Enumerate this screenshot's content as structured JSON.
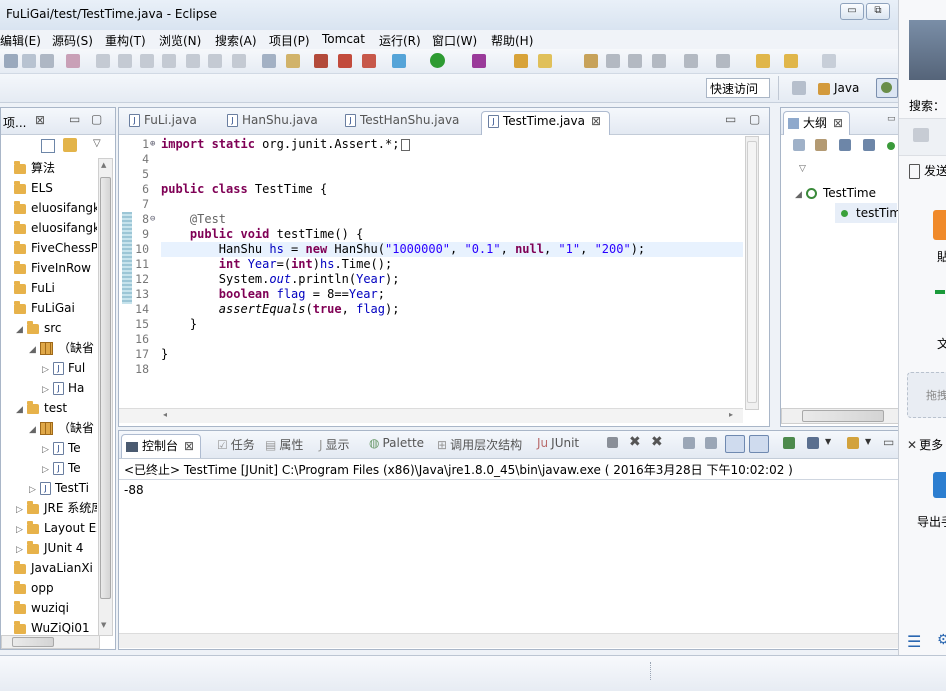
{
  "window": {
    "title": "FuLiGai/test/TestTime.java - Eclipse",
    "btn_min": "▭",
    "btn_max": "⧉"
  },
  "menu": [
    "编辑(E)",
    "源码(S)",
    "重构(T)",
    "浏览(N)",
    "搜索(A)",
    "项目(P)",
    "Tomcat",
    "运行(R)",
    "窗口(W)",
    "帮助(H)"
  ],
  "toolbar": {
    "quick_access": "快速访问",
    "perspective": "Java"
  },
  "explorer": {
    "tab": "项...",
    "rows": [
      {
        "indent": 0,
        "tw": "",
        "label": "算法",
        "kind": "proj"
      },
      {
        "indent": 0,
        "tw": "",
        "label": "ELS",
        "kind": "proj"
      },
      {
        "indent": 0,
        "tw": "",
        "label": "eluosifangku",
        "kind": "proj"
      },
      {
        "indent": 0,
        "tw": "",
        "label": "eluosifangku",
        "kind": "proj"
      },
      {
        "indent": 0,
        "tw": "",
        "label": "FiveChessPro",
        "kind": "proj"
      },
      {
        "indent": 0,
        "tw": "",
        "label": "FiveInRow",
        "kind": "proj"
      },
      {
        "indent": 0,
        "tw": "",
        "label": "FuLi",
        "kind": "proj"
      },
      {
        "indent": 0,
        "tw": "",
        "label": "FuLiGai",
        "kind": "proj"
      },
      {
        "indent": 1,
        "tw": "◢",
        "label": "src",
        "kind": "src"
      },
      {
        "indent": 2,
        "tw": "◢",
        "label": "（缺省",
        "kind": "pkg"
      },
      {
        "indent": 3,
        "tw": "▷",
        "label": "Ful",
        "kind": "java"
      },
      {
        "indent": 3,
        "tw": "▷",
        "label": "Ha",
        "kind": "java"
      },
      {
        "indent": 1,
        "tw": "◢",
        "label": "test",
        "kind": "src"
      },
      {
        "indent": 2,
        "tw": "◢",
        "label": "（缺省",
        "kind": "pkg"
      },
      {
        "indent": 3,
        "tw": "▷",
        "label": "Te",
        "kind": "java"
      },
      {
        "indent": 3,
        "tw": "▷",
        "label": "Te",
        "kind": "java"
      },
      {
        "indent": 2,
        "tw": "▷",
        "label": "TestTi",
        "kind": "java"
      },
      {
        "indent": 1,
        "tw": "▷",
        "label": "JRE 系统库",
        "kind": "lib"
      },
      {
        "indent": 1,
        "tw": "▷",
        "label": "Layout Ex",
        "kind": "proj"
      },
      {
        "indent": 1,
        "tw": "▷",
        "label": "JUnit 4",
        "kind": "lib"
      },
      {
        "indent": 0,
        "tw": "",
        "label": "JavaLianXi",
        "kind": "proj"
      },
      {
        "indent": 0,
        "tw": "",
        "label": "opp",
        "kind": "proj"
      },
      {
        "indent": 0,
        "tw": "",
        "label": "wuziqi",
        "kind": "proj"
      },
      {
        "indent": 0,
        "tw": "",
        "label": "WuZiQi01",
        "kind": "proj"
      }
    ]
  },
  "editor": {
    "tabs": [
      "FuLi.java",
      "HanShu.java",
      "TestHanShu.java",
      "TestTime.java"
    ],
    "active_tab": "TestTime.java",
    "lines": [
      {
        "n": "1",
        "code": [
          {
            "c": "kw",
            "t": "import static "
          },
          {
            "c": "",
            "t": "org.junit.Assert.*;"
          }
        ]
      },
      {
        "n": "4",
        "code": []
      },
      {
        "n": "5",
        "code": []
      },
      {
        "n": "6",
        "code": [
          {
            "c": "kw",
            "t": "public class "
          },
          {
            "c": "",
            "t": "TestTime {"
          }
        ]
      },
      {
        "n": "7",
        "code": []
      },
      {
        "n": "8",
        "code": [
          {
            "c": "",
            "t": "    "
          },
          {
            "c": "ann",
            "t": "@Test"
          }
        ]
      },
      {
        "n": "9",
        "code": [
          {
            "c": "",
            "t": "    "
          },
          {
            "c": "kw",
            "t": "public void "
          },
          {
            "c": "",
            "t": "testTime() {"
          }
        ]
      },
      {
        "n": "10",
        "code": [
          {
            "c": "",
            "t": "        HanShu "
          },
          {
            "c": "fld",
            "t": "hs"
          },
          {
            "c": "",
            "t": " = "
          },
          {
            "c": "kw",
            "t": "new "
          },
          {
            "c": "",
            "t": "HanShu("
          },
          {
            "c": "str",
            "t": "\"1000000\""
          },
          {
            "c": "",
            "t": ", "
          },
          {
            "c": "str",
            "t": "\"0.1\""
          },
          {
            "c": "",
            "t": ", "
          },
          {
            "c": "kw",
            "t": "null"
          },
          {
            "c": "",
            "t": ", "
          },
          {
            "c": "str",
            "t": "\"1\""
          },
          {
            "c": "",
            "t": ", "
          },
          {
            "c": "str",
            "t": "\"200\""
          },
          {
            "c": "",
            "t": ");"
          }
        ]
      },
      {
        "n": "11",
        "code": [
          {
            "c": "",
            "t": "        "
          },
          {
            "c": "kw",
            "t": "int "
          },
          {
            "c": "fld",
            "t": "Year"
          },
          {
            "c": "",
            "t": "=("
          },
          {
            "c": "kw",
            "t": "int"
          },
          {
            "c": "",
            "t": ")"
          },
          {
            "c": "fld",
            "t": "hs"
          },
          {
            "c": "",
            "t": ".Time();"
          }
        ]
      },
      {
        "n": "12",
        "code": [
          {
            "c": "",
            "t": "        System."
          },
          {
            "c": "fld ital",
            "t": "out"
          },
          {
            "c": "",
            "t": ".println("
          },
          {
            "c": "fld",
            "t": "Year"
          },
          {
            "c": "",
            "t": ");"
          }
        ]
      },
      {
        "n": "13",
        "code": [
          {
            "c": "",
            "t": "        "
          },
          {
            "c": "kw",
            "t": "boolean "
          },
          {
            "c": "fld",
            "t": "flag"
          },
          {
            "c": "",
            "t": " = 8=="
          },
          {
            "c": "fld",
            "t": "Year"
          },
          {
            "c": "",
            "t": ";"
          }
        ]
      },
      {
        "n": "14",
        "code": [
          {
            "c": "",
            "t": "        "
          },
          {
            "c": "ital",
            "t": "assertEquals"
          },
          {
            "c": "",
            "t": "("
          },
          {
            "c": "kw",
            "t": "true"
          },
          {
            "c": "",
            "t": ", "
          },
          {
            "c": "fld",
            "t": "flag"
          },
          {
            "c": "",
            "t": ");"
          }
        ]
      },
      {
        "n": "15",
        "code": [
          {
            "c": "",
            "t": "    }"
          }
        ]
      },
      {
        "n": "16",
        "code": []
      },
      {
        "n": "17",
        "code": [
          {
            "c": "",
            "t": "}"
          }
        ]
      },
      {
        "n": "18",
        "code": []
      }
    ]
  },
  "outline": {
    "tab": "大纲",
    "class": "TestTime",
    "method": "testTim"
  },
  "console": {
    "tabs": [
      "控制台",
      "任务",
      "属性",
      "显示",
      "Palette",
      "调用层次结构",
      "JUnit"
    ],
    "header": "<已终止> TestTime [JUnit] C:\\Program Files (x86)\\Java\\jre1.8.0_45\\bin\\javaw.exe ( 2016年3月28日 下午10:02:02 )",
    "output": "-88"
  },
  "chat": {
    "search": "搜索：",
    "send": "发送",
    "more": "更多",
    "export": "导出手",
    "a": "貼",
    "b": "文",
    "c": "拖拽"
  },
  "colors": {
    "accent": "#2a67b1",
    "keyword": "#7f0055",
    "string": "#2a00ff",
    "field": "#0000c0"
  }
}
